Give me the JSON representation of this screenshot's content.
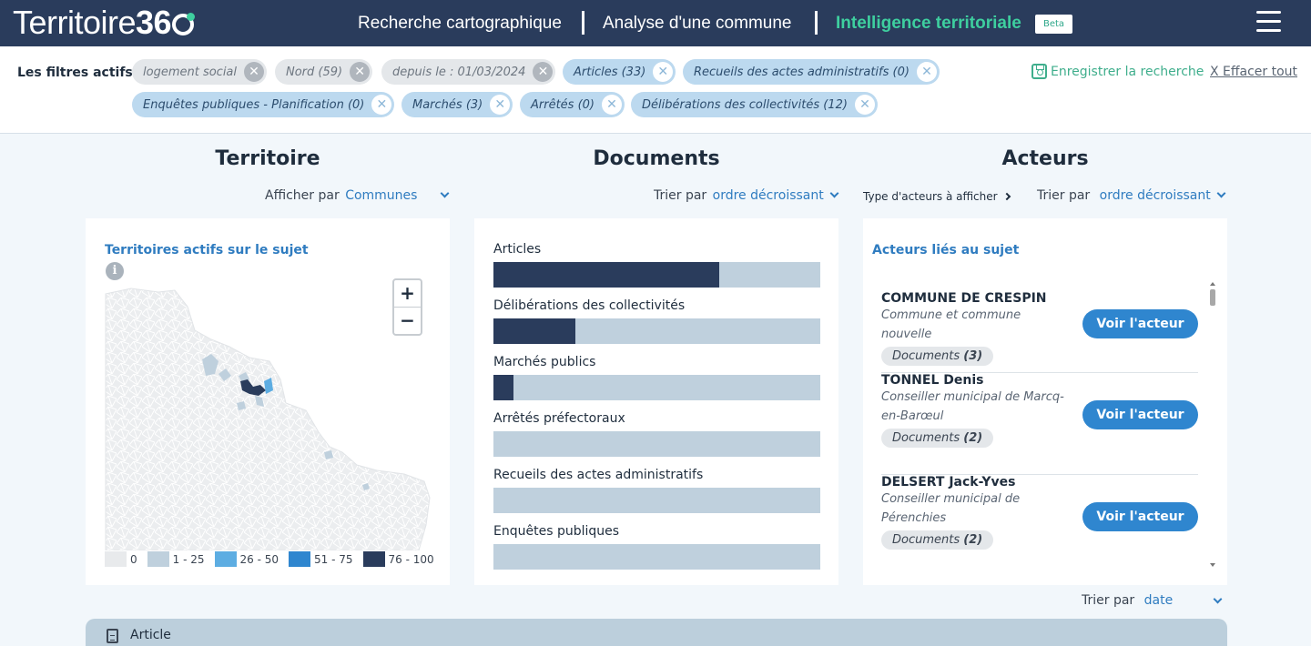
{
  "header": {
    "logo_text": "Territoire",
    "logo_num": "36",
    "nav": [
      "Recherche cartographique",
      "Analyse d'une commune",
      "Intelligence territoriale"
    ],
    "beta": "Beta"
  },
  "filters": {
    "label": "Les filtres actifs",
    "chips": [
      {
        "label": "logement social",
        "style": "grey"
      },
      {
        "label": "Nord (59)",
        "style": "grey"
      },
      {
        "label": "depuis le : 01/03/2024",
        "style": "grey"
      },
      {
        "label": "Articles (33)",
        "style": "blue"
      },
      {
        "label": "Recueils des actes administratifs (0)",
        "style": "blue"
      },
      {
        "label": "Enquêtes publiques - Planification (0)",
        "style": "blue"
      },
      {
        "label": "Marchés (3)",
        "style": "blue"
      },
      {
        "label": "Arrêtés (0)",
        "style": "blue"
      },
      {
        "label": "Délibérations des collectivités (12)",
        "style": "blue"
      }
    ],
    "close_glyph": "✕",
    "save_label": "Enregistrer la recherche",
    "clear_label": "X Effacer tout"
  },
  "territoire": {
    "title": "Territoire",
    "display_label": "Afficher par",
    "display_value": "Communes",
    "card_title": "Territoires actifs sur le sujet",
    "info_glyph": "i",
    "zoom_in": "+",
    "zoom_out": "−",
    "legend": [
      {
        "label": "0",
        "color": "#e8eaec"
      },
      {
        "label": "1 - 25",
        "color": "#bfd0dd"
      },
      {
        "label": "26 - 50",
        "color": "#5dade2"
      },
      {
        "label": "51 - 75",
        "color": "#2f86cf"
      },
      {
        "label": "76 - 100",
        "color": "#2a3c5c"
      }
    ]
  },
  "documents": {
    "title": "Documents",
    "sort_label": "Trier par",
    "sort_value": "ordre décroissant",
    "bars": [
      {
        "label": "Articles",
        "fraction": 0.69
      },
      {
        "label": "Délibérations des collectivités",
        "fraction": 0.25
      },
      {
        "label": "Marchés publics",
        "fraction": 0.06
      },
      {
        "label": "Arrêtés préfectoraux",
        "fraction": 0
      },
      {
        "label": "Recueils des actes administratifs",
        "fraction": 0
      },
      {
        "label": "Enquêtes publiques",
        "fraction": 0
      }
    ]
  },
  "acteurs": {
    "title": "Acteurs",
    "type_label": "Type d'acteurs à afficher",
    "sort_label": "Trier par",
    "sort_value": "ordre décroissant",
    "card_title": "Acteurs liés au sujet",
    "button_label": "Voir l'acteur",
    "list": [
      {
        "name": "COMMUNE DE CRESPIN",
        "role": "Commune et commune nouvelle",
        "docs_label": "Documents",
        "docs_count": "(3)"
      },
      {
        "name": "TONNEL Denis",
        "role": "Conseiller municipal de Marcq-en-Barœul",
        "docs_label": "Documents",
        "docs_count": "(2)"
      },
      {
        "name": "DELSERT Jack-Yves",
        "role": "Conseiller municipal de Pérenchies",
        "docs_label": "Documents",
        "docs_count": "(2)"
      }
    ]
  },
  "results": {
    "sort_label": "Trier par",
    "sort_value": "date",
    "first_section": "Article"
  },
  "colors": {
    "navy": "#2a3c5c",
    "green": "#3ecf9f",
    "blue": "#2f86cf",
    "light_blue": "#bfd0dd"
  }
}
